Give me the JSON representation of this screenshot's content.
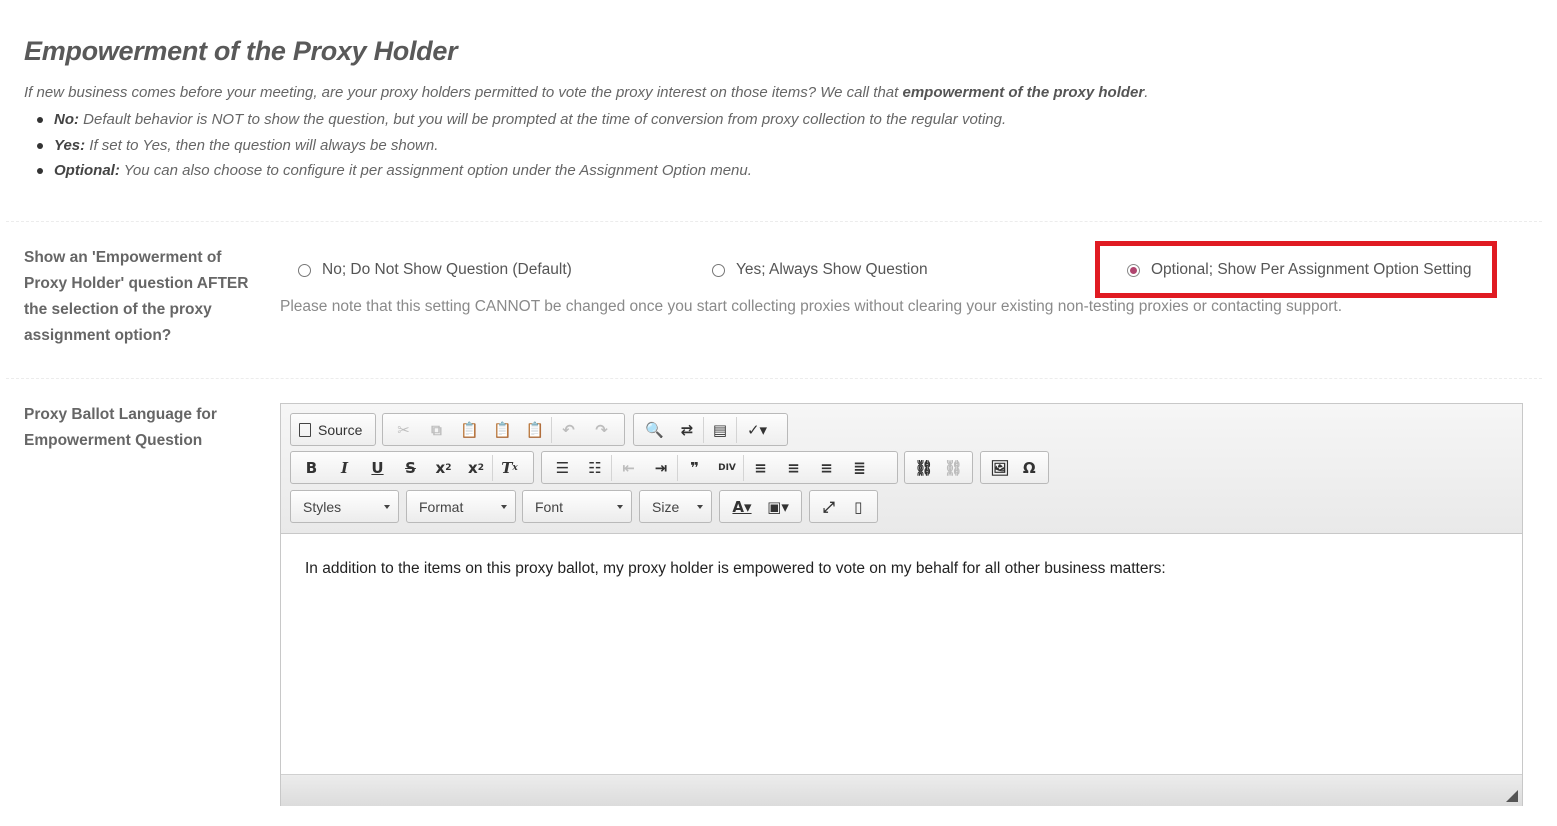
{
  "section": {
    "title": "Empowerment of the Proxy Holder",
    "intro_text": "If new business comes before your meeting, are your proxy holders permitted to vote the proxy interest on those items? We call that ",
    "intro_bold": "empowerment of the proxy holder",
    "intro_end": ".",
    "bullets": [
      {
        "label": "No:",
        "text": " Default behavior is NOT to show the question, but you will be prompted at the time of conversion from proxy collection to the regular voting."
      },
      {
        "label": "Yes:",
        "text": " If set to Yes, then the question will always be shown."
      },
      {
        "label": "Optional:",
        "text": " You can also choose to configure it per assignment option under the Assignment Option menu."
      }
    ]
  },
  "question_field": {
    "label_lines": [
      "Show an 'Empowerment of",
      "Proxy Holder' question AFTER",
      "the selection of the proxy",
      "assignment option?"
    ],
    "options": [
      {
        "label": "No; Do Not Show Question (Default)",
        "checked": false
      },
      {
        "label": "Yes; Always Show Question",
        "checked": false
      },
      {
        "label": "Optional; Show Per Assignment Option Setting",
        "checked": true
      }
    ],
    "note": "Please note that this setting CANNOT be changed once you start collecting proxies without clearing your existing non-testing proxies or contacting support."
  },
  "language_field": {
    "label_lines": [
      "Proxy Ballot Language for",
      "Empowerment Question"
    ]
  },
  "editor": {
    "source_label": "Source",
    "combos": {
      "styles": "Styles",
      "format": "Format",
      "font": "Font",
      "size": "Size"
    },
    "content": "In addition to the items on this proxy ballot, my proxy holder is empowered to vote on my behalf for all other business matters:"
  },
  "colors": {
    "highlight": "#e01b22",
    "radio_checked": "#b0456f"
  }
}
